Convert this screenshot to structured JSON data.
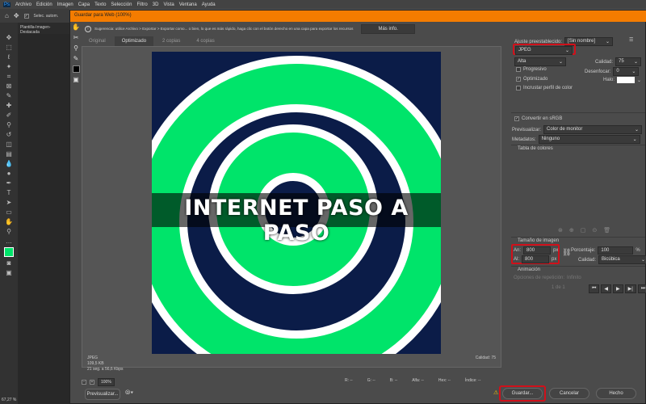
{
  "app": {
    "menu": [
      "Archivo",
      "Edición",
      "Imagen",
      "Capa",
      "Texto",
      "Selección",
      "Filtro",
      "3D",
      "Vista",
      "Ventana",
      "Ayuda"
    ],
    "options_label": "Selec. autom.",
    "doc_tab": "Plantilla-Imagen-Destacada",
    "zoom_status": "67,27 %"
  },
  "dialog": {
    "title": "Guardar para Web (100%)",
    "hint": "Sugerencia: utilice Archivo > Exportar > Exportar como... o bien, lo que es más rápido, haga clic con el botón derecho en una capa para exportar los recursos",
    "more_info": "Más info.",
    "tabs": [
      {
        "label": "Original"
      },
      {
        "label": "Optimizado"
      },
      {
        "label": "2 copias"
      },
      {
        "label": "4 copias"
      }
    ],
    "artwork_text": "INTERNET PASO A PASO",
    "status": {
      "format": "JPEG",
      "size": "109,5 KB",
      "time": "21 seg. a 56,6 Kbps",
      "quality": "Calidad: 75"
    },
    "zoom": "100%",
    "readouts": [
      "R: --",
      "G: --",
      "B: --",
      "Alfa: --",
      "Hex: --",
      "Índice: --"
    ],
    "preview_button": "Previsualizar...",
    "save_button": "Guardar...",
    "cancel_button": "Cancelar",
    "done_button": "Hecho"
  },
  "settings": {
    "preset_label": "Ajuste preestablecido:",
    "preset_value": "[Sin nombre]",
    "format": "JPEG",
    "quality_level": "Alta",
    "quality_label": "Calidad:",
    "quality_value": "75",
    "progressive": "Progresivo",
    "progressive_checked": false,
    "blur_label": "Desenfocar:",
    "blur_value": "0",
    "optimized": "Optimizado",
    "optimized_checked": true,
    "matte_label": "Halo:",
    "matte_color": "#ffffff",
    "embed_profile": "Incrustar perfil de color",
    "embed_checked": false,
    "srgb": "Convertir en sRGB",
    "srgb_checked": true,
    "preview_label": "Previsualizar:",
    "preview_value": "Color de monitor",
    "metadata_label": "Metadatos:",
    "metadata_value": "Ninguno",
    "color_table": "Tabla de colores",
    "image_size": "Tamaño de imagen",
    "width_label": "An:",
    "width": "800",
    "height_label": "Al:",
    "height": "800",
    "unit": "px",
    "percent_label": "Porcentaje:",
    "percent": "100",
    "percent_unit": "%",
    "resample_label": "Calidad:",
    "resample": "Bicúbica",
    "animation": "Animación",
    "loop_label": "Opciones de repetición:",
    "loop_value": "Infinito",
    "frame": "1 de 1"
  },
  "colors": {
    "accent": "#f47c00",
    "highlight": "#d0101a",
    "art_bg": "#0b1c48",
    "art_green": "#00e46a"
  }
}
